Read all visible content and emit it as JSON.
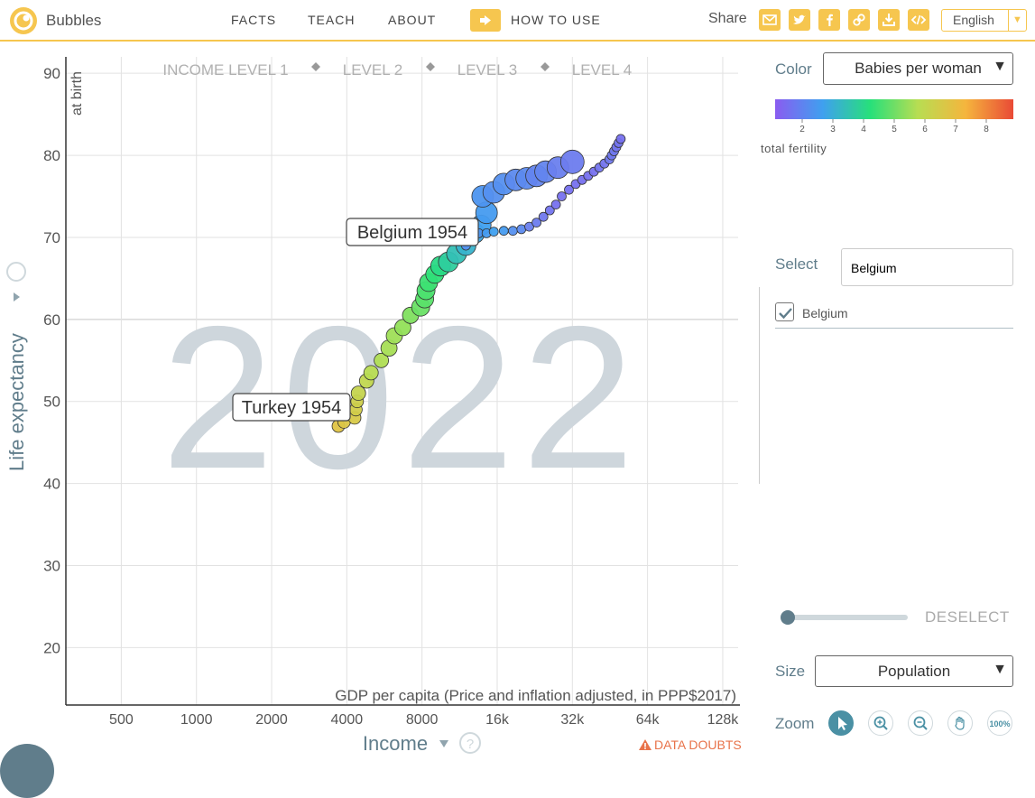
{
  "app": {
    "brand": "Bubbles"
  },
  "nav": {
    "facts": "FACTS",
    "teach": "TEACH",
    "about": "ABOUT",
    "how_to_use": "HOW TO USE"
  },
  "share": {
    "label": "Share",
    "icons": [
      "mail-icon",
      "twitter-icon",
      "facebook-icon",
      "link-icon",
      "download-icon",
      "embed-icon"
    ]
  },
  "language": {
    "selected": "English"
  },
  "colors": {
    "accent": "#f6c64f",
    "axis": "#607d8b",
    "year_watermark": "#ced6dc"
  },
  "chart": {
    "year": "2022",
    "income_levels": [
      "INCOME LEVEL 1",
      "LEVEL 2",
      "LEVEL 3",
      "LEVEL 4"
    ],
    "y_axis": {
      "label": "Life expectancy",
      "sublabel": "at birth",
      "ticks": [
        "90",
        "80",
        "70",
        "60",
        "50",
        "40",
        "30",
        "20"
      ]
    },
    "x_axis": {
      "label": "Income",
      "sublabel": "GDP per capita (Price and inflation adjusted, in PPP$2017)",
      "ticks": [
        "500",
        "1000",
        "2000",
        "4000",
        "8000",
        "16k",
        "32k",
        "64k",
        "128k"
      ]
    },
    "data_doubts": "DATA DOUBTS",
    "labels": [
      {
        "text": "Belgium 1954",
        "country": "Belgium",
        "year": 1954
      },
      {
        "text": "Turkey 1954",
        "country": "Turkey",
        "year": 1954
      }
    ]
  },
  "chart_data": {
    "type": "scatter",
    "x_scale": "log",
    "xlim": [
      300,
      150000
    ],
    "ylim": [
      13,
      92
    ],
    "series": [
      {
        "name": "Turkey",
        "points": [
          [
            3700,
            47
          ],
          [
            3900,
            47.5
          ],
          [
            4300,
            48
          ],
          [
            4350,
            49
          ],
          [
            4400,
            50
          ],
          [
            4450,
            51
          ],
          [
            4800,
            52.5
          ],
          [
            5000,
            53.5
          ],
          [
            5500,
            55
          ],
          [
            5900,
            56.5
          ],
          [
            6200,
            58
          ],
          [
            6700,
            59
          ],
          [
            7200,
            60.5
          ],
          [
            7900,
            61.5
          ],
          [
            8200,
            62.5
          ],
          [
            8300,
            63.5
          ],
          [
            8500,
            64.5
          ],
          [
            9000,
            65.5
          ],
          [
            9500,
            66.5
          ],
          [
            10200,
            67
          ],
          [
            11000,
            68
          ],
          [
            12000,
            69
          ],
          [
            13000,
            70.5
          ],
          [
            13800,
            71.5
          ],
          [
            14500,
            73
          ],
          [
            14000,
            75
          ],
          [
            15500,
            75.5
          ],
          [
            17000,
            76.5
          ],
          [
            19000,
            77
          ],
          [
            21000,
            77.2
          ],
          [
            23000,
            77.5
          ],
          [
            25000,
            78
          ],
          [
            28000,
            78.5
          ],
          [
            32000,
            79.2
          ]
        ],
        "babies_per_woman": [
          6.9,
          6.8,
          6.7,
          6.6,
          6.5,
          6.3,
          6.2,
          6.0,
          5.8,
          5.6,
          5.4,
          5.1,
          4.8,
          4.5,
          4.3,
          4.1,
          3.9,
          3.7,
          3.5,
          3.3,
          3.1,
          2.9,
          2.7,
          2.6,
          2.5,
          2.4,
          2.3,
          2.3,
          2.2,
          2.2,
          2.1,
          2.1,
          2.0,
          1.9
        ],
        "sizes": [
          7,
          7,
          7,
          7,
          7,
          8,
          8,
          8,
          8,
          9,
          9,
          9,
          9,
          10,
          10,
          10,
          10,
          10,
          11,
          11,
          11,
          11,
          11,
          11,
          12,
          12,
          12,
          12,
          12,
          12,
          12,
          12,
          12,
          13
        ]
      },
      {
        "name": "Belgium",
        "points": [
          [
            12000,
            69
          ],
          [
            12800,
            70
          ],
          [
            13500,
            70.5
          ],
          [
            14500,
            70.5
          ],
          [
            15500,
            70.7
          ],
          [
            17000,
            70.8
          ],
          [
            18500,
            70.8
          ],
          [
            20000,
            71
          ],
          [
            21500,
            71.3
          ],
          [
            23000,
            71.8
          ],
          [
            24500,
            72.5
          ],
          [
            26000,
            73.3
          ],
          [
            27500,
            74
          ],
          [
            29000,
            75
          ],
          [
            31000,
            75.8
          ],
          [
            33000,
            76.5
          ],
          [
            35000,
            77
          ],
          [
            37000,
            77.5
          ],
          [
            39000,
            78
          ],
          [
            41000,
            78.5
          ],
          [
            43000,
            79
          ],
          [
            45000,
            79.5
          ],
          [
            46000,
            80
          ],
          [
            47000,
            80.5
          ],
          [
            48000,
            81
          ],
          [
            49000,
            81.5
          ],
          [
            50000,
            82
          ]
        ],
        "babies_per_woman": [
          2.3,
          2.3,
          2.4,
          2.5,
          2.6,
          2.5,
          2.3,
          2.2,
          2.0,
          1.9,
          1.8,
          1.7,
          1.6,
          1.6,
          1.6,
          1.6,
          1.6,
          1.6,
          1.6,
          1.7,
          1.7,
          1.8,
          1.8,
          1.8,
          1.7,
          1.7,
          1.6
        ],
        "sizes": [
          5,
          5,
          5,
          5,
          5,
          5,
          5,
          5,
          5,
          5,
          5,
          5,
          5,
          5,
          5,
          5,
          5,
          5,
          5,
          5,
          5,
          5,
          5,
          5,
          5,
          5,
          5
        ]
      }
    ]
  },
  "sidebar": {
    "color": {
      "label": "Color",
      "value": "Babies per woman",
      "legend_ticks": [
        "2",
        "3",
        "4",
        "5",
        "6",
        "7",
        "8"
      ],
      "legend_title": "total fertility"
    },
    "select": {
      "label": "Select",
      "value": "Belgium",
      "items": [
        "Belgium"
      ]
    },
    "deselect": "DESELECT",
    "size": {
      "label": "Size",
      "value": "Population"
    },
    "zoom": {
      "label": "Zoom",
      "buttons": [
        "cursor-icon",
        "zoom-in-icon",
        "zoom-out-icon",
        "hand-icon"
      ],
      "reset_label": "100%"
    }
  }
}
